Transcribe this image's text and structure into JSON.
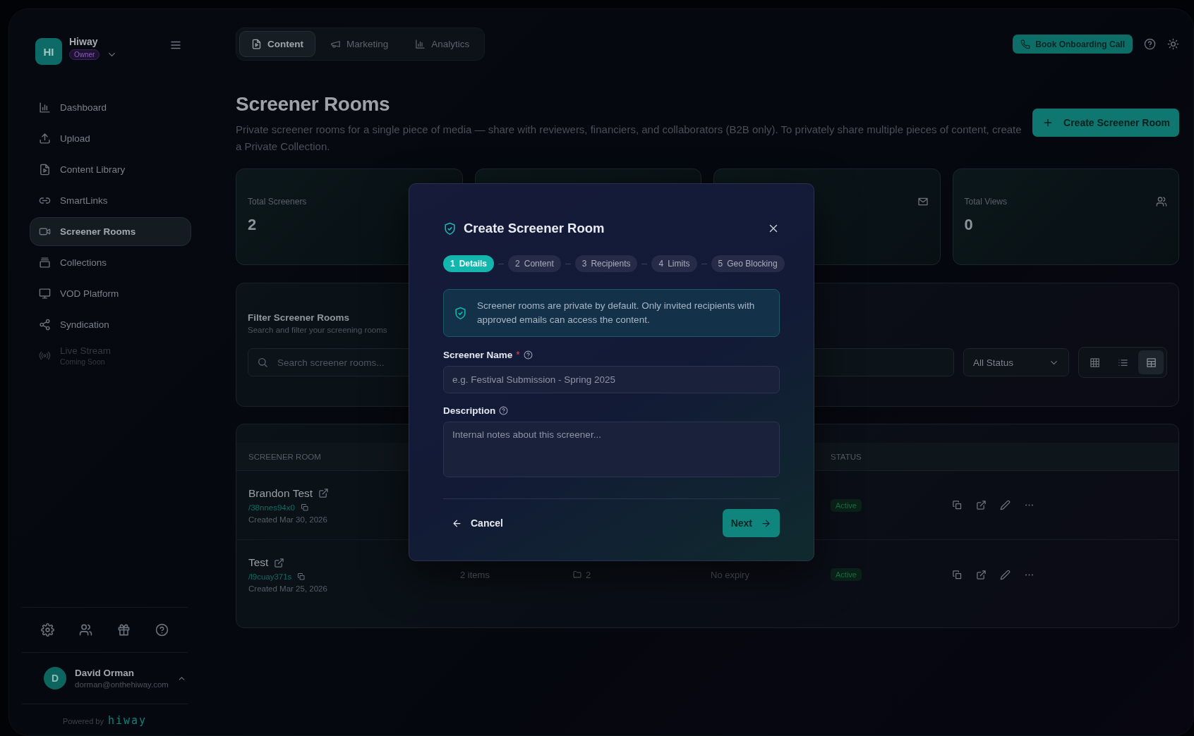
{
  "sidebar": {
    "workspace": {
      "initials": "HI",
      "name": "Hiway",
      "role": "Owner"
    },
    "nav_items": [
      {
        "label": "Dashboard",
        "selected": false,
        "disabled": false
      },
      {
        "label": "Upload",
        "selected": false,
        "disabled": false
      },
      {
        "label": "Content Library",
        "selected": false,
        "disabled": false
      },
      {
        "label": "SmartLinks",
        "selected": false,
        "disabled": false
      },
      {
        "label": "Screener Rooms",
        "selected": true,
        "disabled": false
      },
      {
        "label": "Collections",
        "selected": false,
        "disabled": false
      },
      {
        "label": "VOD Platform",
        "selected": false,
        "disabled": false
      },
      {
        "label": "Syndication",
        "selected": false,
        "disabled": false
      },
      {
        "label": "Live Stream",
        "note": "Coming Soon",
        "selected": false,
        "disabled": true
      }
    ],
    "user": {
      "initial": "D",
      "name": "David Orman",
      "email": "dorman@onthehiway.com"
    },
    "powered_by": {
      "text": "Powered by",
      "brand": "hiway"
    }
  },
  "top_tabs": [
    {
      "label": "Content",
      "selected": true
    },
    {
      "label": "Marketing",
      "selected": false
    },
    {
      "label": "Analytics",
      "selected": false
    }
  ],
  "book_button": "Book Onboarding Call",
  "page": {
    "title": "Screener Rooms",
    "description": "Private screener rooms for a single piece of media — share with reviewers, financiers, and collaborators (B2B only). To privately share multiple pieces of content, create a Private Collection.",
    "create_button": "Create Screener Room"
  },
  "stats": [
    {
      "kind": "stat",
      "label": "Total Screeners",
      "value": "2"
    },
    {
      "kind": "covered"
    },
    {
      "kind": "covered"
    },
    {
      "kind": "stat",
      "label": "Total Views",
      "value": "0"
    }
  ],
  "filter": {
    "title": "Filter Screener Rooms",
    "subtitle": "Search and filter your screening rooms",
    "search": {
      "placeholder": "Search screener rooms..."
    },
    "status_select": "All Status",
    "view_modes": [
      {
        "selected": false
      },
      {
        "selected": false
      },
      {
        "selected": true
      }
    ]
  },
  "table": {
    "columns": [
      "SCREENER ROOM",
      "STATUS"
    ],
    "rows": [
      {
        "name": "Brandon Test",
        "slug": "/38nnes94x0",
        "created": "Created Mar 30, 2026",
        "status": "Active"
      },
      {
        "name": "Test",
        "slug": "/l9cuay371s",
        "created": "Created Mar 25, 2026",
        "items": "2 items",
        "recipients": "2",
        "expiry": "No expiry",
        "status": "Active"
      }
    ]
  },
  "modal": {
    "title": "Create Screener Room",
    "steps": [
      {
        "number": "1",
        "label": "Details",
        "selected": true
      },
      {
        "number": "2",
        "label": "Content",
        "selected": false
      },
      {
        "number": "3",
        "label": "Recipients",
        "selected": false
      },
      {
        "number": "4",
        "label": "Limits",
        "selected": false
      },
      {
        "number": "5",
        "label": "Geo Blocking",
        "selected": false
      }
    ],
    "notice": "Screener rooms are private by default. Only invited recipients with approved emails can access the content.",
    "fields": [
      {
        "kind": "input",
        "label": "Screener Name",
        "required_mark": "*",
        "placeholder": "e.g. Festival Submission - Spring 2025"
      },
      {
        "kind": "textarea",
        "label": "Description",
        "placeholder": "Internal notes about this screener..."
      }
    ],
    "cancel": "Cancel",
    "next": "Next"
  }
}
